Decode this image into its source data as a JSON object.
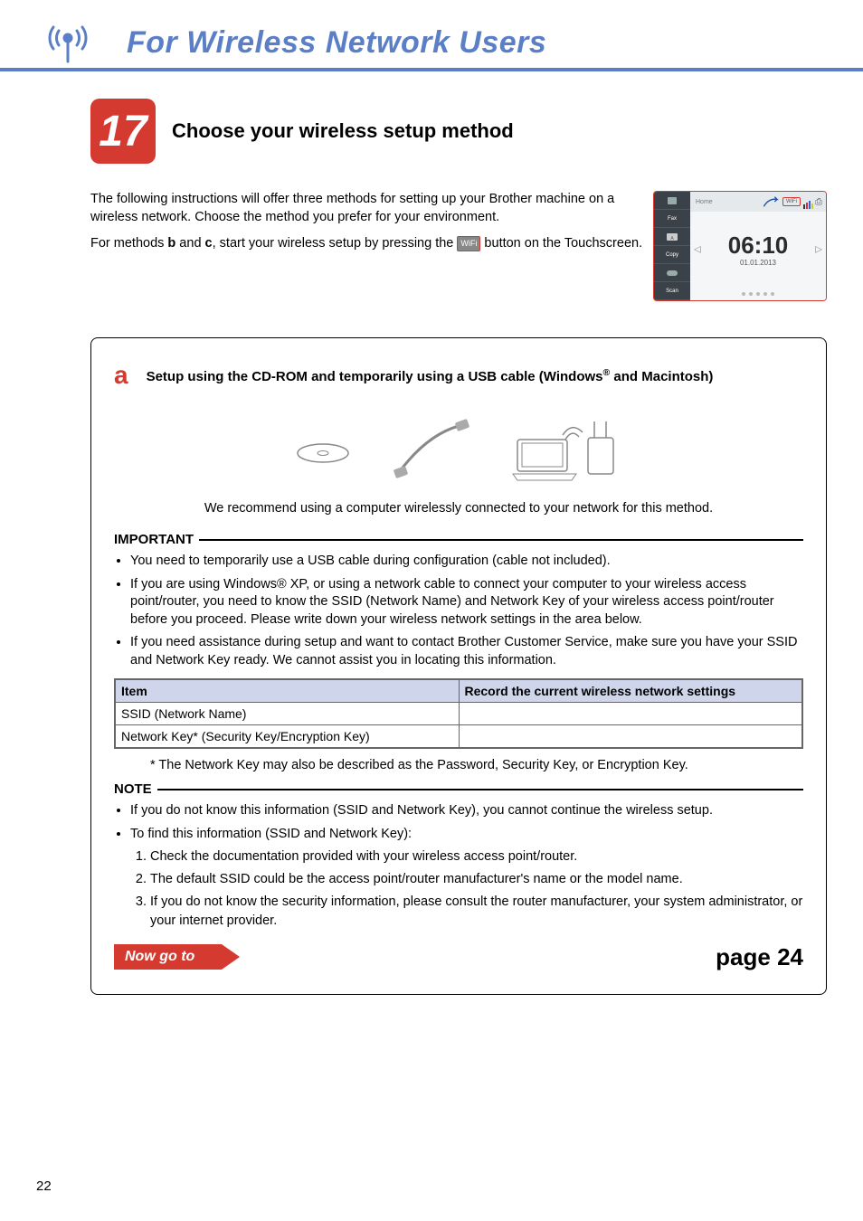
{
  "banner": {
    "title": "For Wireless Network Users",
    "icon_name": "wireless-antenna-icon"
  },
  "step": {
    "number": "17",
    "title": "Choose your wireless setup method"
  },
  "intro": {
    "p1": "The following instructions will offer three methods for setting up your Brother machine on a wireless network. Choose the method you prefer for your environment.",
    "p2_a": "For methods ",
    "p2_b": "b",
    "p2_c": " and ",
    "p2_d": "c",
    "p2_e": ", start your wireless setup by pressing the ",
    "p2_f": " button on the Touchscreen.",
    "wifi_chip_label": "WiFi"
  },
  "screen": {
    "left_items": [
      "Fax",
      "Copy",
      "Scan"
    ],
    "home_label": "Home",
    "wifi_label": "WiFi",
    "time": "06:10",
    "date": "01.01.2013"
  },
  "option_a": {
    "letter": "a",
    "title_pre": "Setup using the CD-ROM and temporarily using a USB cable (Windows",
    "title_sup": "®",
    "title_post": " and Macintosh)",
    "recommend": "We recommend using a computer wirelessly connected to your network for this method.",
    "important_label": "IMPORTANT",
    "bullets": [
      "You need to temporarily use a USB cable during configuration (cable not included).",
      "If you are using Windows® XP, or using a network cable to connect your computer to your wireless access point/router, you need to know the SSID (Network Name) and Network Key of your wireless access point/router before you proceed. Please write down your wireless network settings in the area below.",
      "If you need assistance during setup and want to contact Brother Customer Service, make sure you have your SSID and Network Key ready. We cannot assist you in locating this information."
    ],
    "table": {
      "h1": "Item",
      "h2": "Record the current wireless network settings",
      "r1": "SSID (Network Name)",
      "r2": "Network Key* (Security Key/Encryption Key)"
    },
    "asterisk": "*  The Network Key may also be described as the Password, Security Key, or Encryption Key.",
    "note_label": "NOTE",
    "note_b1": "If you do not know this information (SSID and Network Key), you cannot continue the wireless setup.",
    "note_b2": "To find this information (SSID and Network Key):",
    "note_list": [
      "Check the documentation provided with your wireless access point/router.",
      "The default SSID could be the access point/router manufacturer's name or the model name.",
      "If you do not know the security information, please consult the router manufacturer, your system administrator, or your internet provider."
    ],
    "goto_label": "Now go to",
    "goto_page": "page 24"
  },
  "page_number": "22"
}
